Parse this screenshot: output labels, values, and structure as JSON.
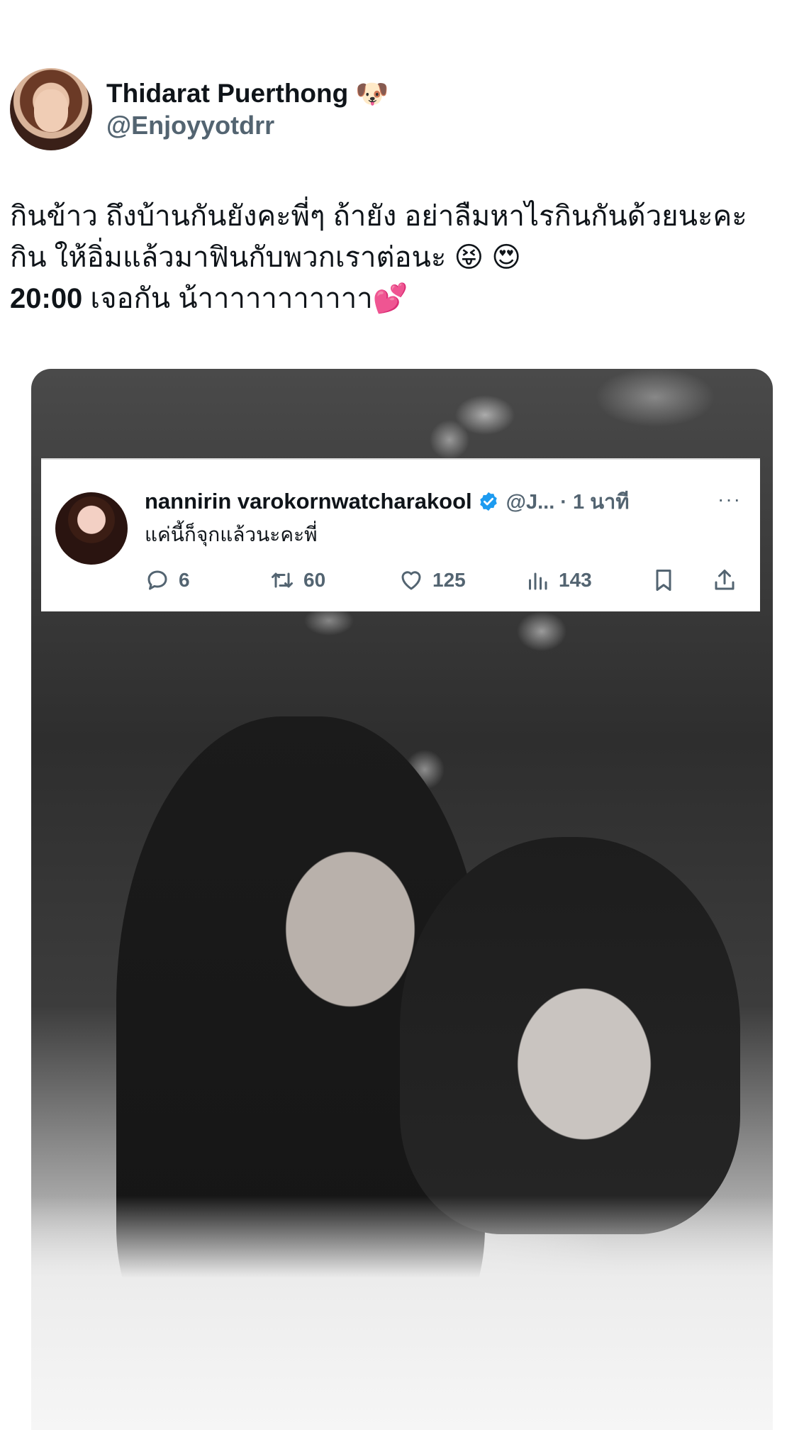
{
  "author": {
    "display_name": "Thidarat Puerthong",
    "badge_emoji": "🐶",
    "handle": "@Enjoyyotdrr",
    "avatar_icon": "profile-photo"
  },
  "tweet": {
    "line1": "กินข้าว ถึงบ้านกันยังคะพี่ๆ ถ้ายัง อย่าลืมหาไรกินกันด้วยนะคะ",
    "line2_text": "กิน ให้อิ่มแล้วมาฟินกับพวกเราต่อนะ",
    "line2_emoji1": "😝",
    "line2_emoji2": "😍",
    "line3_time": "20:00",
    "line3_text": " เจอกัน น้าาาาาาาาาาา",
    "line3_emoji": "💕"
  },
  "quoted": {
    "name": "nannirin varokornwatcharakool",
    "handle_time": "@J... · 1 นาที",
    "more": "···",
    "text": "แค่นี้ก็จุกแล้วนะคะพี่",
    "reply_count": "6",
    "retweet_count": "60",
    "like_count": "125",
    "views_count": "143",
    "verified_color": "#1d9bf0"
  }
}
